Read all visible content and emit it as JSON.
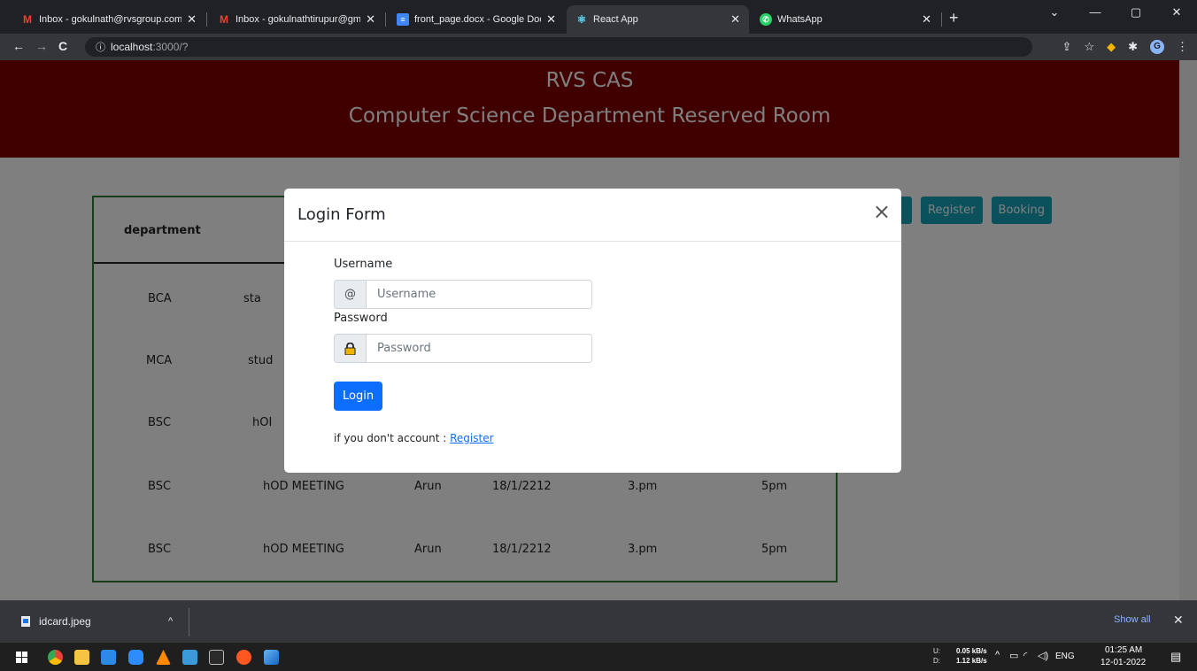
{
  "browser": {
    "tabs": [
      {
        "title": "Inbox - gokulnath@rvsgroup.com",
        "icon": "gmail-icon"
      },
      {
        "title": "Inbox - gokulnathtirupur@gmail.",
        "icon": "gmail-icon"
      },
      {
        "title": "front_page.docx - Google Docs",
        "icon": "google-docs-icon"
      },
      {
        "title": "React App",
        "icon": "react-icon"
      },
      {
        "title": "WhatsApp",
        "icon": "whatsapp-icon"
      }
    ],
    "address": {
      "host": "localhost",
      "path": ":3000/?"
    }
  },
  "banner": {
    "line1": "RVS CAS",
    "line2": "Computer Science Department Reserved Room",
    "color": "#800000"
  },
  "nav_buttons": {
    "register": "Register",
    "booking": "Booking"
  },
  "table": {
    "header_first": "department",
    "rows": [
      {
        "department": "BCA",
        "purpose": "sta"
      },
      {
        "department": "MCA",
        "purpose": "stud"
      },
      {
        "department": "BSC",
        "purpose": "hOI"
      },
      {
        "department": "BSC",
        "purpose": "hOD MEETING",
        "name": "Arun",
        "date": "18/1/2212",
        "from": "3.pm",
        "to": "5pm"
      },
      {
        "department": "BSC",
        "purpose": "hOD MEETING",
        "name": "Arun",
        "date": "18/1/2212",
        "from": "3.pm",
        "to": "5pm"
      }
    ]
  },
  "modal": {
    "title": "Login Form",
    "close": "×",
    "username_label": "Username",
    "username_addon": "@",
    "username_placeholder": "Username",
    "password_label": "Password",
    "password_placeholder": "Password",
    "login_button": "Login",
    "register_prompt": "if you don't account : ",
    "register_link": "Register"
  },
  "downloads": {
    "file": "idcard.jpeg",
    "show_all": "Show all"
  },
  "taskbar": {
    "upload_label": "U:",
    "download_label": "D:",
    "upload_speed": "0.05 kB/s",
    "download_speed": "1.12 kB/s",
    "language": "ENG",
    "time": "01:25 AM",
    "date": "12-01-2022"
  }
}
